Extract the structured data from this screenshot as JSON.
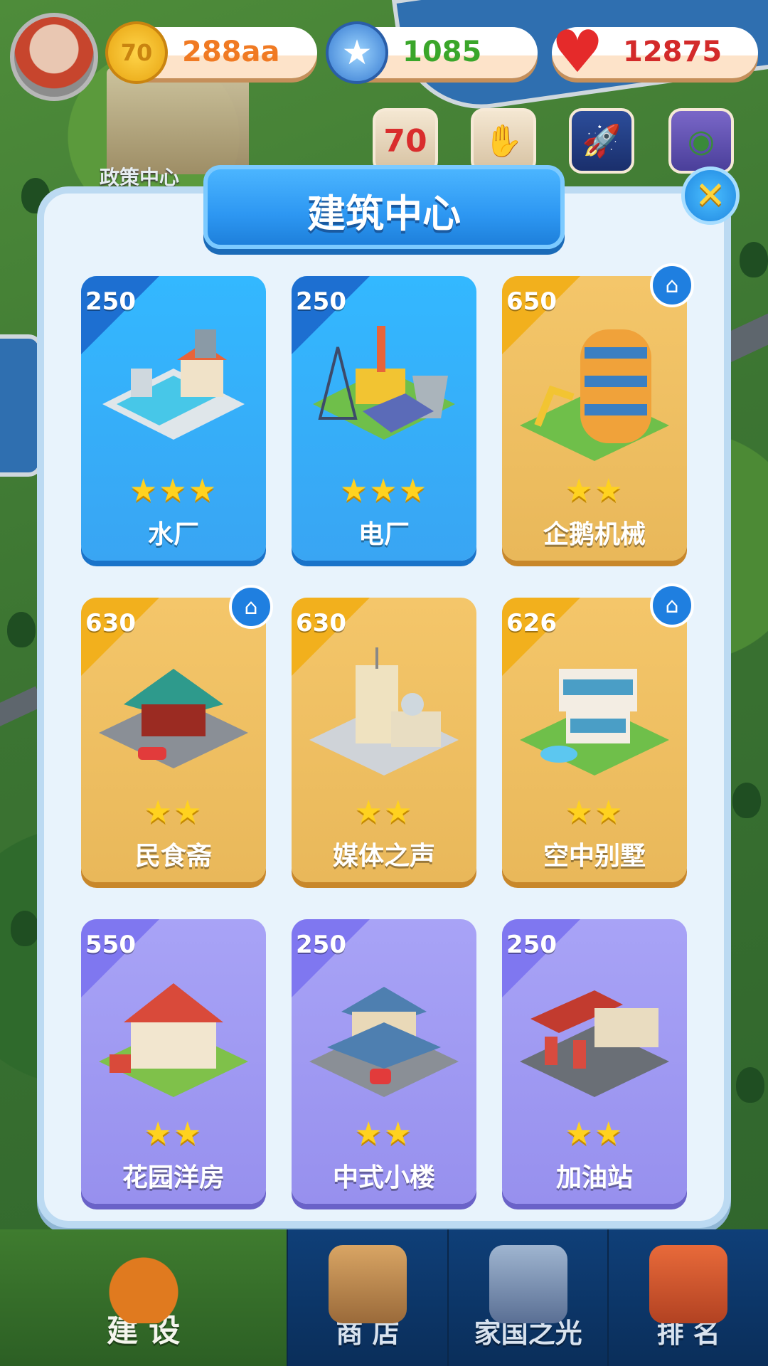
{
  "resources": {
    "coins": {
      "icon": "coin-icon",
      "value": "288aa",
      "color": "#f07a23"
    },
    "gems": {
      "icon": "gem-icon",
      "value": "1085",
      "color": "#3aa62a"
    },
    "hearts": {
      "icon": "heart-icon",
      "value": "12875",
      "color": "#d32a2a"
    }
  },
  "background": {
    "label": "政策中心"
  },
  "utility_icons": [
    {
      "name": "anniversary-70-icon",
      "text": "70"
    },
    {
      "name": "handshake-icon",
      "text": ""
    },
    {
      "name": "rocket-icon",
      "text": ""
    },
    {
      "name": "globe-icon",
      "text": ""
    }
  ],
  "modal": {
    "title": "建筑中心",
    "close_icon": "close-icon",
    "buildings": [
      {
        "name": "水厂",
        "price": "250",
        "stars": 3,
        "theme": "blue",
        "home_badge": false
      },
      {
        "name": "电厂",
        "price": "250",
        "stars": 3,
        "theme": "blue",
        "home_badge": false
      },
      {
        "name": "企鹅机械",
        "price": "650",
        "stars": 2,
        "theme": "gold",
        "home_badge": true
      },
      {
        "name": "民食斋",
        "price": "630",
        "stars": 2,
        "theme": "gold",
        "home_badge": true
      },
      {
        "name": "媒体之声",
        "price": "630",
        "stars": 2,
        "theme": "gold",
        "home_badge": false
      },
      {
        "name": "空中别墅",
        "price": "626",
        "stars": 2,
        "theme": "gold",
        "home_badge": true
      },
      {
        "name": "花园洋房",
        "price": "550",
        "stars": 2,
        "theme": "purple",
        "home_badge": false
      },
      {
        "name": "中式小楼",
        "price": "250",
        "stars": 2,
        "theme": "purple",
        "home_badge": false
      },
      {
        "name": "加油站",
        "price": "250",
        "stars": 2,
        "theme": "purple",
        "home_badge": false
      }
    ]
  },
  "nav": [
    {
      "label": "建 设",
      "icon": "hardhat-icon",
      "active": true
    },
    {
      "label": "商 店",
      "icon": "shop-icon",
      "active": false
    },
    {
      "label": "家国之光",
      "icon": "rocket-icon",
      "active": false
    },
    {
      "label": "排 名",
      "icon": "podium-icon",
      "active": false
    }
  ]
}
